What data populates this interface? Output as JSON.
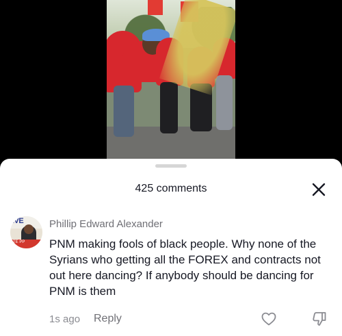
{
  "comments_header": {
    "count_label": "425 comments",
    "close_icon": "close-icon"
  },
  "comment": {
    "author": "Phillip Edward Alexander",
    "avatar_text": "IVE",
    "avatar_small_text": "TE   PP",
    "text": "PNM making fools of black people. Why none of the Syrians who getting all the FOREX and contracts not out here dancing? If anybody should be dancing for PNM is them",
    "time": "1s ago",
    "reply_label": "Reply",
    "like_icon": "heart-icon",
    "dislike_icon": "thumbs-down-icon"
  },
  "colors": {
    "sheet_background": "#ffffff",
    "primary_text": "#161823",
    "secondary_text": "#6f6f75"
  }
}
